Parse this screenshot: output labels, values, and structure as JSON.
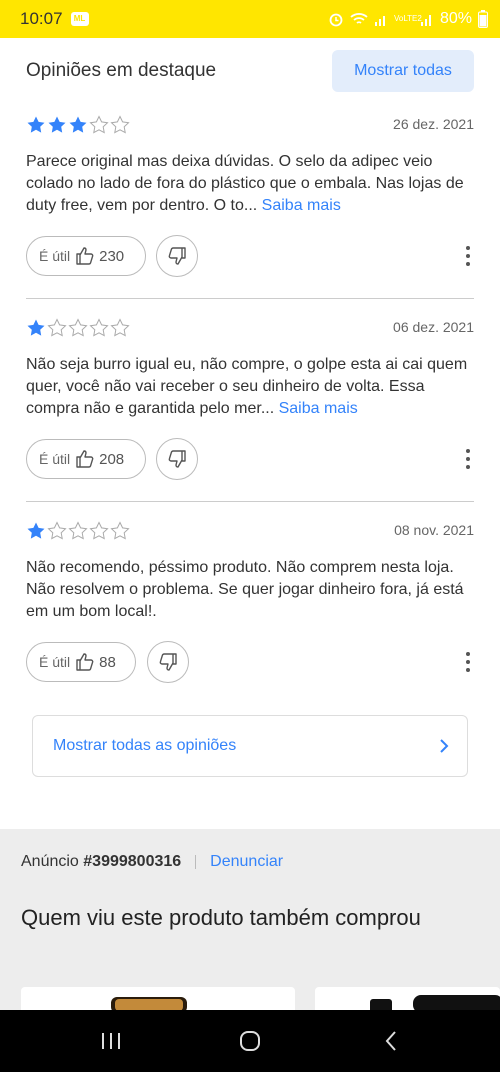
{
  "status": {
    "time": "10:07",
    "app_badge": "ML",
    "network": "VoLTE2",
    "battery": "80%"
  },
  "reviews_section": {
    "title": "Opiniões em destaque",
    "show_all_label": "Mostrar todas",
    "read_more_label": "Saiba mais",
    "useful_label": "É útil",
    "items": [
      {
        "rating": 3,
        "date": "26 dez. 2021",
        "text": "Parece original mas deixa dúvidas. O selo da adipec veio colado no lado de fora do plástico que o embala. Nas lojas de duty free, vem por dentro. O to...",
        "likes": "230"
      },
      {
        "rating": 1,
        "date": "06 dez. 2021",
        "text": "Não seja burro igual eu, não compre, o golpe esta ai cai quem quer, você não vai receber o seu dinheiro de volta. Essa compra não e garantida pelo mer...",
        "likes": "208"
      },
      {
        "rating": 1,
        "date": "08 nov. 2021",
        "text": "Não recomendo, péssimo produto. Não comprem nesta loja. Não resolvem o problema. Se quer jogar dinheiro fora, já está em um bom local!.",
        "likes": "88"
      }
    ],
    "all_opinions_label": "Mostrar todas as opiniões"
  },
  "listing": {
    "ad_label": "Anúncio",
    "ad_number": "#3999800316",
    "report_label": "Denunciar"
  },
  "recommendations": {
    "title": "Quem viu este produto também comprou"
  },
  "colors": {
    "brand_yellow": "#ffe600",
    "accent_blue": "#3483fa",
    "star_blue": "#3483fa"
  }
}
